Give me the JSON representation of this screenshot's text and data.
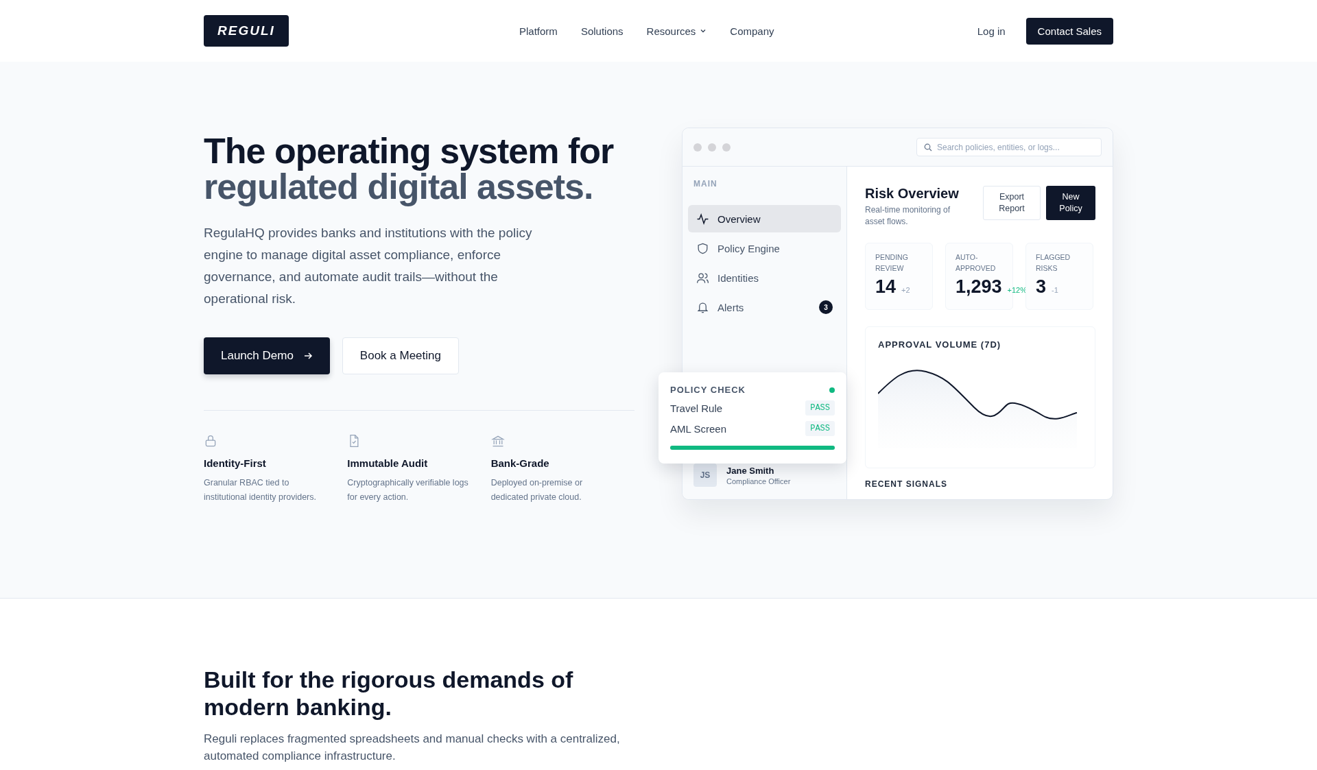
{
  "header": {
    "logo": "REGULI",
    "nav": [
      {
        "label": "Platform",
        "has_caret": false
      },
      {
        "label": "Solutions",
        "has_caret": false
      },
      {
        "label": "Resources",
        "has_caret": true
      },
      {
        "label": "Company",
        "has_caret": false
      }
    ],
    "login": "Log in",
    "cta": "Contact Sales"
  },
  "hero": {
    "title_line_1": "The operating system for",
    "title_line_2": "regulated digital assets.",
    "description": "RegulaHQ provides banks and institutions with the policy engine to manage digital asset compliance, enforce governance, and automate audit trails—without the operational risk.",
    "buttons": [
      {
        "label": "Launch Demo",
        "kind": "primary"
      },
      {
        "label": "Book a Meeting",
        "kind": "secondary"
      }
    ],
    "features": [
      {
        "kind": "lock",
        "title": "Identity-First",
        "text": "Granular RBAC tied to institutional identity providers."
      },
      {
        "kind": "document",
        "title": "Immutable Audit",
        "text": "Cryptographically verifiable logs for every action."
      },
      {
        "kind": "bank",
        "title": "Bank-Grade",
        "text": "Deployed on-premise or dedicated private cloud."
      }
    ]
  },
  "dashboard": {
    "search": {
      "placeholder": "Search policies, entities, or logs..."
    },
    "sidebar": {
      "heading": "MAIN",
      "items": [
        {
          "label": "Overview",
          "kind": "pulse",
          "selected": true
        },
        {
          "label": "Policy Engine",
          "kind": "shield",
          "selected": false
        },
        {
          "label": "Identities",
          "kind": "users",
          "selected": false
        },
        {
          "label": "Alerts",
          "kind": "bell",
          "selected": false,
          "badge": "3"
        }
      ],
      "user": {
        "initials": "JS",
        "name": "Jane Smith",
        "role": "Compliance Officer"
      }
    },
    "title": "Risk Overview",
    "subtitle": "Real-time monitoring of asset flows.",
    "actions": [
      {
        "label": "Export Report",
        "kind": "secondary"
      },
      {
        "label": "New Policy",
        "kind": "primary"
      }
    ],
    "stats": [
      {
        "label": "PENDING REVIEW",
        "value": "14",
        "delta": "+2",
        "positive": false
      },
      {
        "label": "AUTO-APPROVED",
        "value": "1,293",
        "delta": "+12%",
        "positive": true
      },
      {
        "label": "FLAGGED RISKS",
        "value": "3",
        "delta": "-1",
        "positive": false
      }
    ],
    "chart_title": "APPROVAL VOLUME (7D)",
    "recent_heading": "RECENT SIGNALS",
    "policy_check": {
      "title": "POLICY CHECK",
      "color": "#10b981",
      "rows": [
        {
          "label": "Travel Rule",
          "result": "PASS"
        },
        {
          "label": "AML Screen",
          "result": "PASS"
        }
      ],
      "level": 1
    }
  },
  "section": {
    "title": "Built for the rigorous demands of modern banking.",
    "text": "Reguli replaces fragmented spreadsheets and manual checks with a centralized, automated compliance infrastructure."
  }
}
